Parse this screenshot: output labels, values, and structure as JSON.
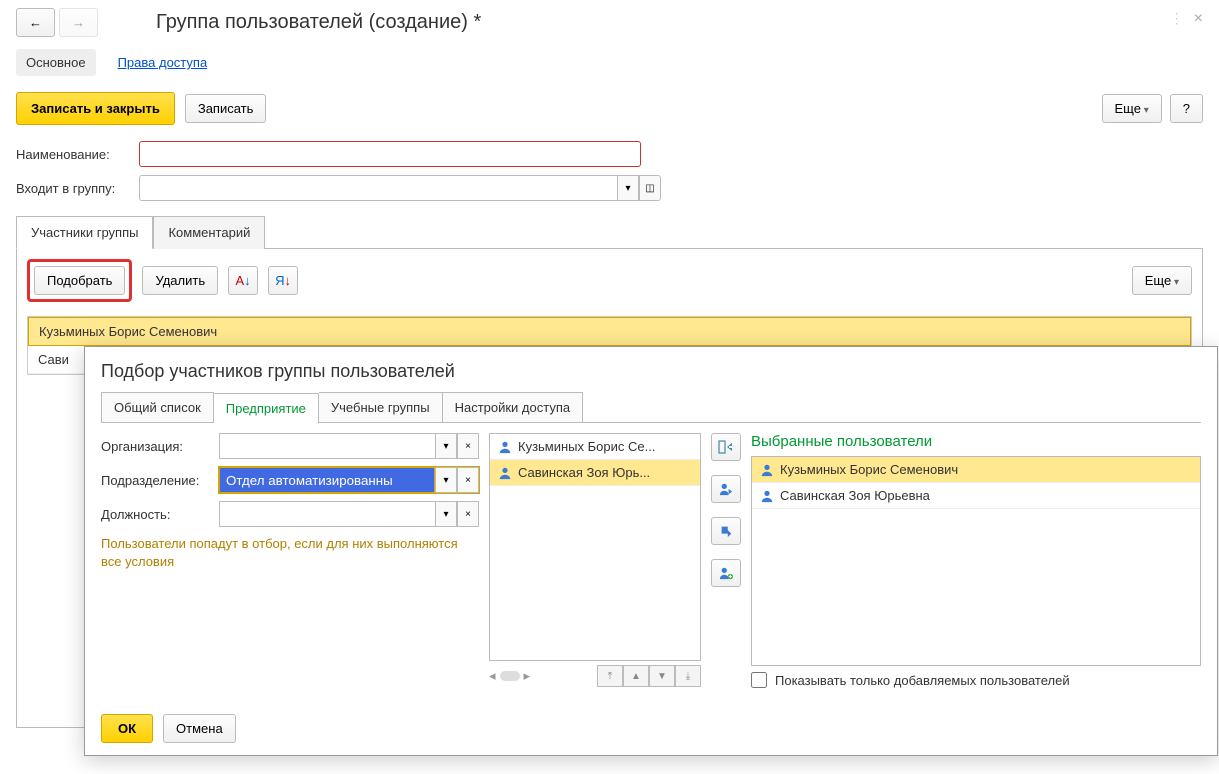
{
  "page_title": "Группа пользователей (создание) *",
  "nav_tabs": {
    "main": "Основное",
    "access": "Права доступа"
  },
  "toolbar": {
    "save_close": "Записать и закрыть",
    "save": "Записать",
    "more": "Еще",
    "help": "?"
  },
  "fields": {
    "name_label": "Наименование:",
    "group_label": "Входит в группу:"
  },
  "inner_tabs": {
    "members": "Участники группы",
    "comment": "Комментарий"
  },
  "grid_toolbar": {
    "pick": "Подобрать",
    "delete": "Удалить",
    "more": "Еще"
  },
  "grid_rows": [
    "Кузьминых Борис Семенович",
    "Сави"
  ],
  "dialog": {
    "title": "Подбор участников группы пользователей",
    "tabs": [
      "Общий список",
      "Предприятие",
      "Учебные группы",
      "Настройки доступа"
    ],
    "active_tab": 1,
    "filters": {
      "org_label": "Организация:",
      "dept_label": "Подразделение:",
      "dept_value": "Отдел автоматизированны",
      "pos_label": "Должность:",
      "hint": "Пользователи попадут в отбор, если для них выполняются все условия"
    },
    "available": [
      "Кузьминых Борис Се...",
      "Савинская Зоя Юрь..."
    ],
    "selected_title": "Выбранные пользователи",
    "selected": [
      "Кузьминых Борис Семенович",
      "Савинская Зоя Юрьевна"
    ],
    "show_added_only": "Показывать только добавляемых пользователей",
    "ok": "ОК",
    "cancel": "Отмена"
  }
}
